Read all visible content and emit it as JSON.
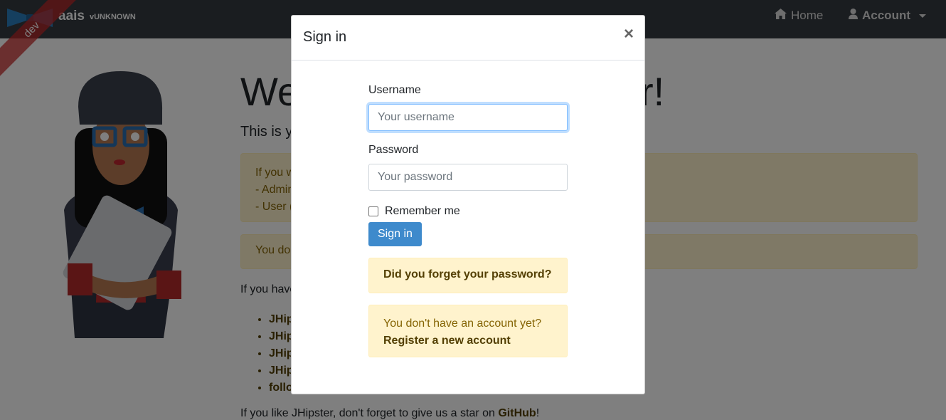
{
  "navbar": {
    "brand_name": "aais",
    "brand_version": "vUNKNOWN",
    "ribbon_text": "dev",
    "home_label": "Home",
    "account_label": "Account",
    "home_icon": "home-icon",
    "account_icon": "user-icon"
  },
  "page": {
    "title_start": "We",
    "title_end": "r!",
    "subtitle_start": "This is y",
    "alert_1_lines": [
      "If you w",
      "- Admin",
      "- User ("
    ],
    "alert_2_text": "You do",
    "list_intro": "If you have",
    "list_items": [
      "JHip",
      "JHip",
      "JHip",
      "JHip",
      "follo"
    ],
    "footer_text": "If you like JHipster, don't forget to give us a star on ",
    "footer_link": "GitHub",
    "footer_end": "!"
  },
  "modal": {
    "title": "Sign in",
    "close_symbol": "×",
    "username_label": "Username",
    "username_placeholder": "Your username",
    "password_label": "Password",
    "password_placeholder": "Your password",
    "remember_label": "Remember me",
    "signin_button": "Sign in",
    "forgot_password": "Did you forget your password?",
    "no_account_text": "You don't have an account yet?",
    "register_link": "Register a new account"
  },
  "colors": {
    "navbar_bg": "#343a40",
    "primary": "#3e8acc",
    "alert_bg": "#fff3cd",
    "alert_text": "#856404"
  }
}
